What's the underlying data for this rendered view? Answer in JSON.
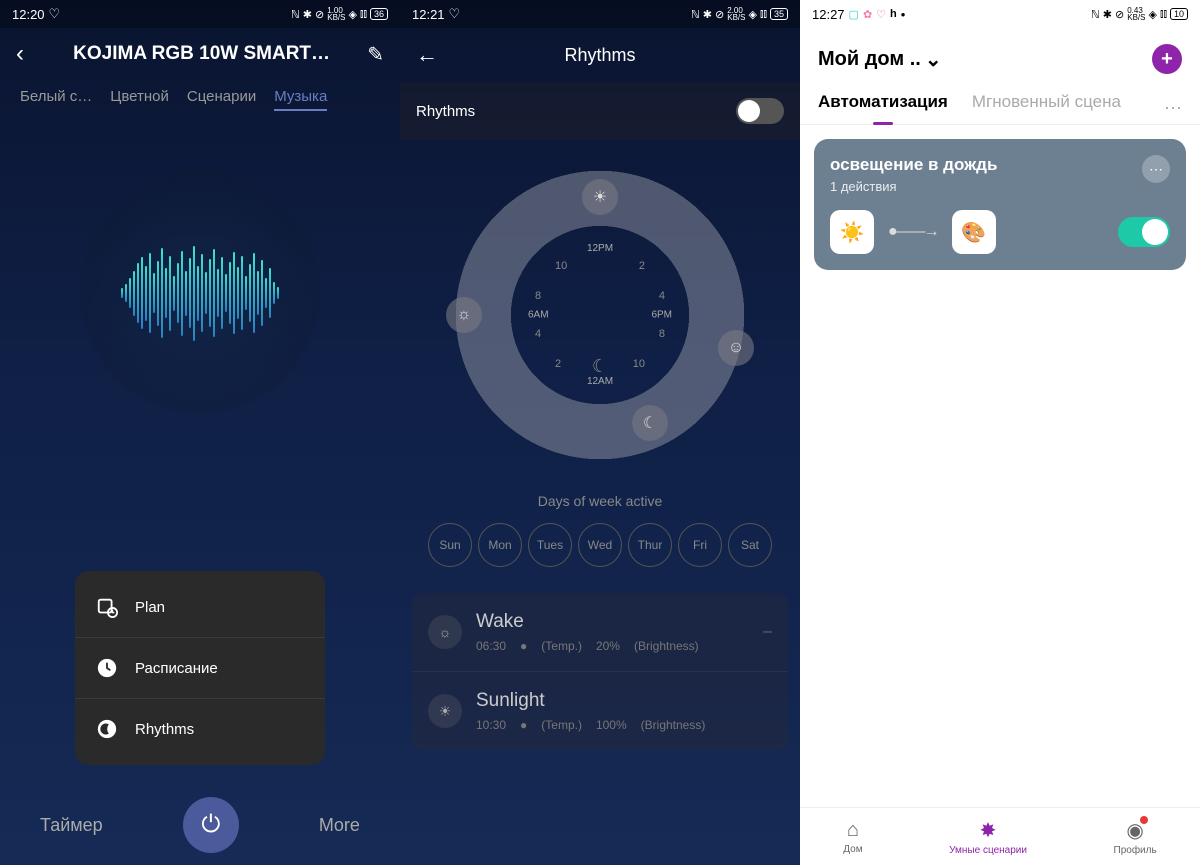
{
  "screen1": {
    "status": {
      "time": "12:20",
      "speed": "1.00",
      "speedUnit": "KB/S",
      "battery": "36"
    },
    "title": "KOJIMA RGB 10W SMART…",
    "tabs": [
      "Белый с…",
      "Цветной",
      "Сценарии",
      "Музыка"
    ],
    "popup": [
      {
        "label": "Plan"
      },
      {
        "label": "Расписание"
      },
      {
        "label": "Rhythms"
      }
    ],
    "bottom": {
      "timer": "Таймер",
      "more": "More"
    }
  },
  "screen2": {
    "status": {
      "time": "12:21",
      "speed": "2.00",
      "speedUnit": "KB/S",
      "battery": "35"
    },
    "title": "Rhythms",
    "toggleLabel": "Rhythms",
    "ring": {
      "top": "12PM",
      "right": "6PM",
      "bottom": "12AM",
      "left": "6AM",
      "hours": [
        "2",
        "4",
        "8",
        "10",
        "2",
        "4",
        "8",
        "10"
      ]
    },
    "daysLabel": "Days of week active",
    "days": [
      "Sun",
      "Mon",
      "Tues",
      "Wed",
      "Thur",
      "Fri",
      "Sat"
    ],
    "items": [
      {
        "name": "Wake",
        "time": "06:30",
        "metaA": "(Temp.)",
        "pct": "20%",
        "metaB": "(Brightness)"
      },
      {
        "name": "Sunlight",
        "time": "10:30",
        "metaA": "(Temp.)",
        "pct": "100%",
        "metaB": "(Brightness)"
      }
    ]
  },
  "screen3": {
    "status": {
      "time": "12:27",
      "speed": "0.43",
      "speedUnit": "KB/S",
      "battery": "10"
    },
    "home": "Мой дом ..",
    "tabs": {
      "a": "Автоматизация",
      "b": "Мгновенный сцена"
    },
    "card": {
      "title": "освещение в дождь",
      "sub": "1 действия"
    },
    "nav": {
      "home": "Дом",
      "scenes": "Умные сценарии",
      "profile": "Профиль"
    }
  }
}
